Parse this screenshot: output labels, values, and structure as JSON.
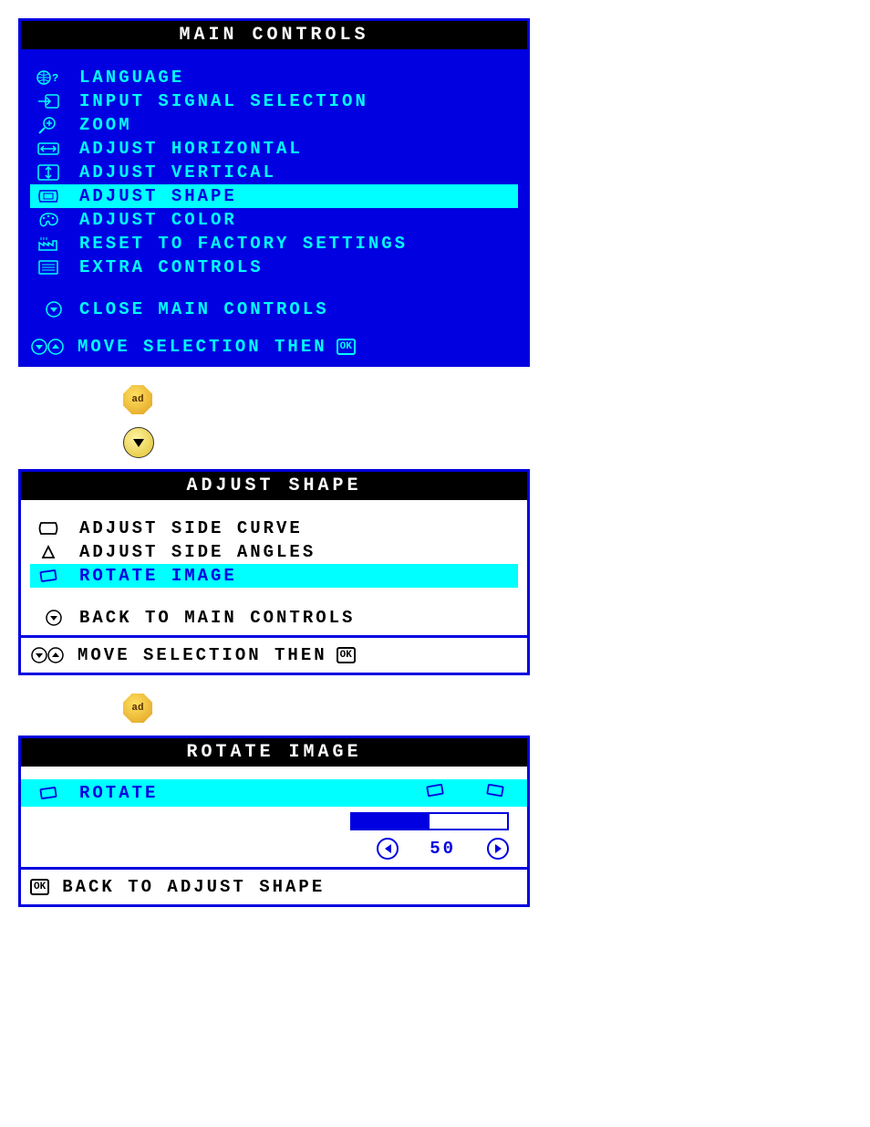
{
  "main": {
    "title": "MAIN CONTROLS",
    "items": [
      {
        "icon": "globe-question-icon",
        "label": "LANGUAGE"
      },
      {
        "icon": "input-arrow-icon",
        "label": "INPUT SIGNAL SELECTION"
      },
      {
        "icon": "magnify-plus-icon",
        "label": "ZOOM"
      },
      {
        "icon": "horiz-arrows-icon",
        "label": "ADJUST HORIZONTAL"
      },
      {
        "icon": "vert-arrows-icon",
        "label": "ADJUST VERTICAL"
      },
      {
        "icon": "shape-icon",
        "label": "ADJUST SHAPE",
        "selected": true
      },
      {
        "icon": "palette-icon",
        "label": "ADJUST COLOR"
      },
      {
        "icon": "factory-icon",
        "label": "RESET TO FACTORY SETTINGS"
      },
      {
        "icon": "list-icon",
        "label": "EXTRA CONTROLS"
      }
    ],
    "close": "CLOSE MAIN CONTROLS",
    "footer": "MOVE SELECTION THEN",
    "ok": "OK"
  },
  "buttons": {
    "ok_label": "ad",
    "down_label": "▼"
  },
  "shape": {
    "title": "ADJUST SHAPE",
    "items": [
      {
        "icon": "side-curve-icon",
        "label": "ADJUST SIDE CURVE"
      },
      {
        "icon": "side-angles-icon",
        "label": "ADJUST SIDE ANGLES"
      },
      {
        "icon": "rotate-icon",
        "label": "ROTATE IMAGE",
        "selected": true
      }
    ],
    "back": "BACK TO MAIN CONTROLS",
    "footer": "MOVE SELECTION THEN",
    "ok": "OK"
  },
  "rotate": {
    "title": "ROTATE IMAGE",
    "label": "ROTATE",
    "value": "50",
    "percent": 50,
    "back": "BACK TO ADJUST SHAPE",
    "ok": "OK"
  }
}
